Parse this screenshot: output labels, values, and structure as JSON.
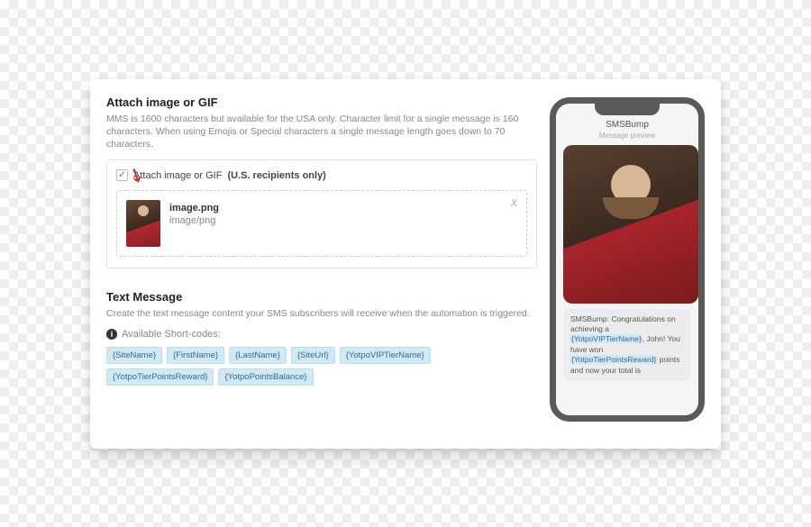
{
  "attach": {
    "heading": "Attach image or GIF",
    "description": "MMS is 1600 characters but available for the USA only. Character limit for a single message is 160 characters. When using Emojis or Special characters a single message length goes down to 70 characters.",
    "checkbox_label": "Attach image or GIF",
    "checkbox_suffix": "(U.S. recipients only)",
    "file": {
      "name": "image.png",
      "mime": "image/png"
    },
    "remove_label": "X"
  },
  "text_message": {
    "heading": "Text Message",
    "description": "Create the text message content your SMS subscribers will receive when the automation is triggered.",
    "available_label": "Available Short-codes:",
    "shortcodes": [
      "{SiteName}",
      "{FirstName}",
      "{LastName}",
      "{SiteUrl}",
      "{YotpoVIPTierName}",
      "{YotpoTierPointsReward}",
      "{YotpoPointsBalance}"
    ]
  },
  "preview": {
    "app_title": "SMSBump",
    "subtitle": "Message preview",
    "bubble_prefix": "SMSBump: Congratulations on achieving a ",
    "code1": "{YotpoVIPTierName}",
    "bubble_mid": ", John! You have won ",
    "code2": "{YotpoTierPointsReward}",
    "bubble_suffix": " points and now your total is"
  }
}
